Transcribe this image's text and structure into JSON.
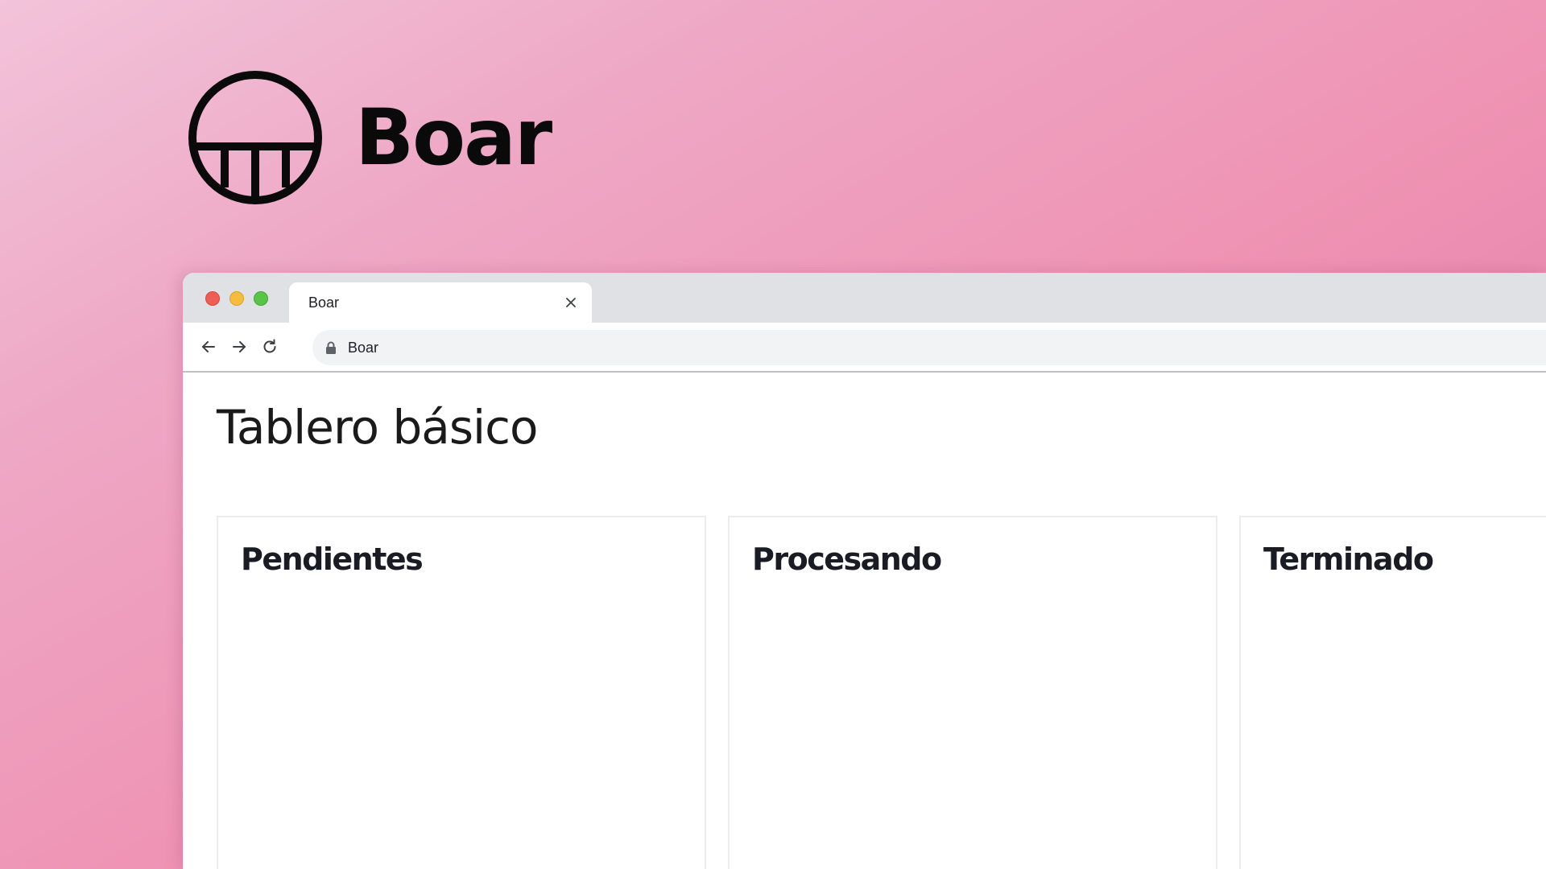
{
  "hero": {
    "brand_name": "Boar",
    "logo_icon": "boar-logo-icon"
  },
  "browser": {
    "window_controls": {
      "close_color": "#ee5e55",
      "minimize_color": "#f4bd3b",
      "maximize_color": "#5ac34a"
    },
    "tab": {
      "title": "Boar",
      "close_icon": "close-icon"
    },
    "toolbar": {
      "back_icon": "arrow-left-icon",
      "forward_icon": "arrow-right-icon",
      "reload_icon": "reload-icon",
      "lock_icon": "lock-icon",
      "address_text": "Boar"
    }
  },
  "page": {
    "title": "Tablero básico",
    "columns": [
      {
        "title": "Pendientes"
      },
      {
        "title": "Procesando"
      },
      {
        "title": "Terminado"
      }
    ]
  },
  "colors": {
    "background_gradient_start": "#f2c3da",
    "background_gradient_end": "#c679b6",
    "text_dark": "#0a0a0a",
    "tab_strip": "#dfe1e5",
    "omnibox": "#f1f3f4"
  }
}
